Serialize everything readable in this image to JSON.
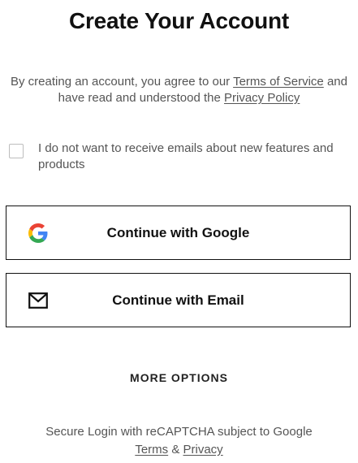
{
  "page": {
    "title": "Create Your Account"
  },
  "terms": {
    "prefix": "By creating an account, you agree to our ",
    "tos_link": "Terms of Service",
    "middle": " and have read and understood the ",
    "privacy_link": "Privacy Policy"
  },
  "opt_out": {
    "label": "I do not want to receive emails about new features and products",
    "checked": false
  },
  "buttons": {
    "google": {
      "label": "Continue with Google",
      "icon": "google-icon"
    },
    "email": {
      "label": "Continue with Email",
      "icon": "mail-icon"
    }
  },
  "more_options": {
    "label": "MORE OPTIONS"
  },
  "recaptcha": {
    "text": "Secure Login with reCAPTCHA subject to Google",
    "terms_link": "Terms",
    "separator": " & ",
    "privacy_link": "Privacy"
  },
  "colors": {
    "text": "#111111",
    "muted": "#555555",
    "border": "#111111",
    "google_blue": "#4285F4",
    "google_red": "#EA4335",
    "google_yellow": "#FBBC05",
    "google_green": "#34A853"
  }
}
